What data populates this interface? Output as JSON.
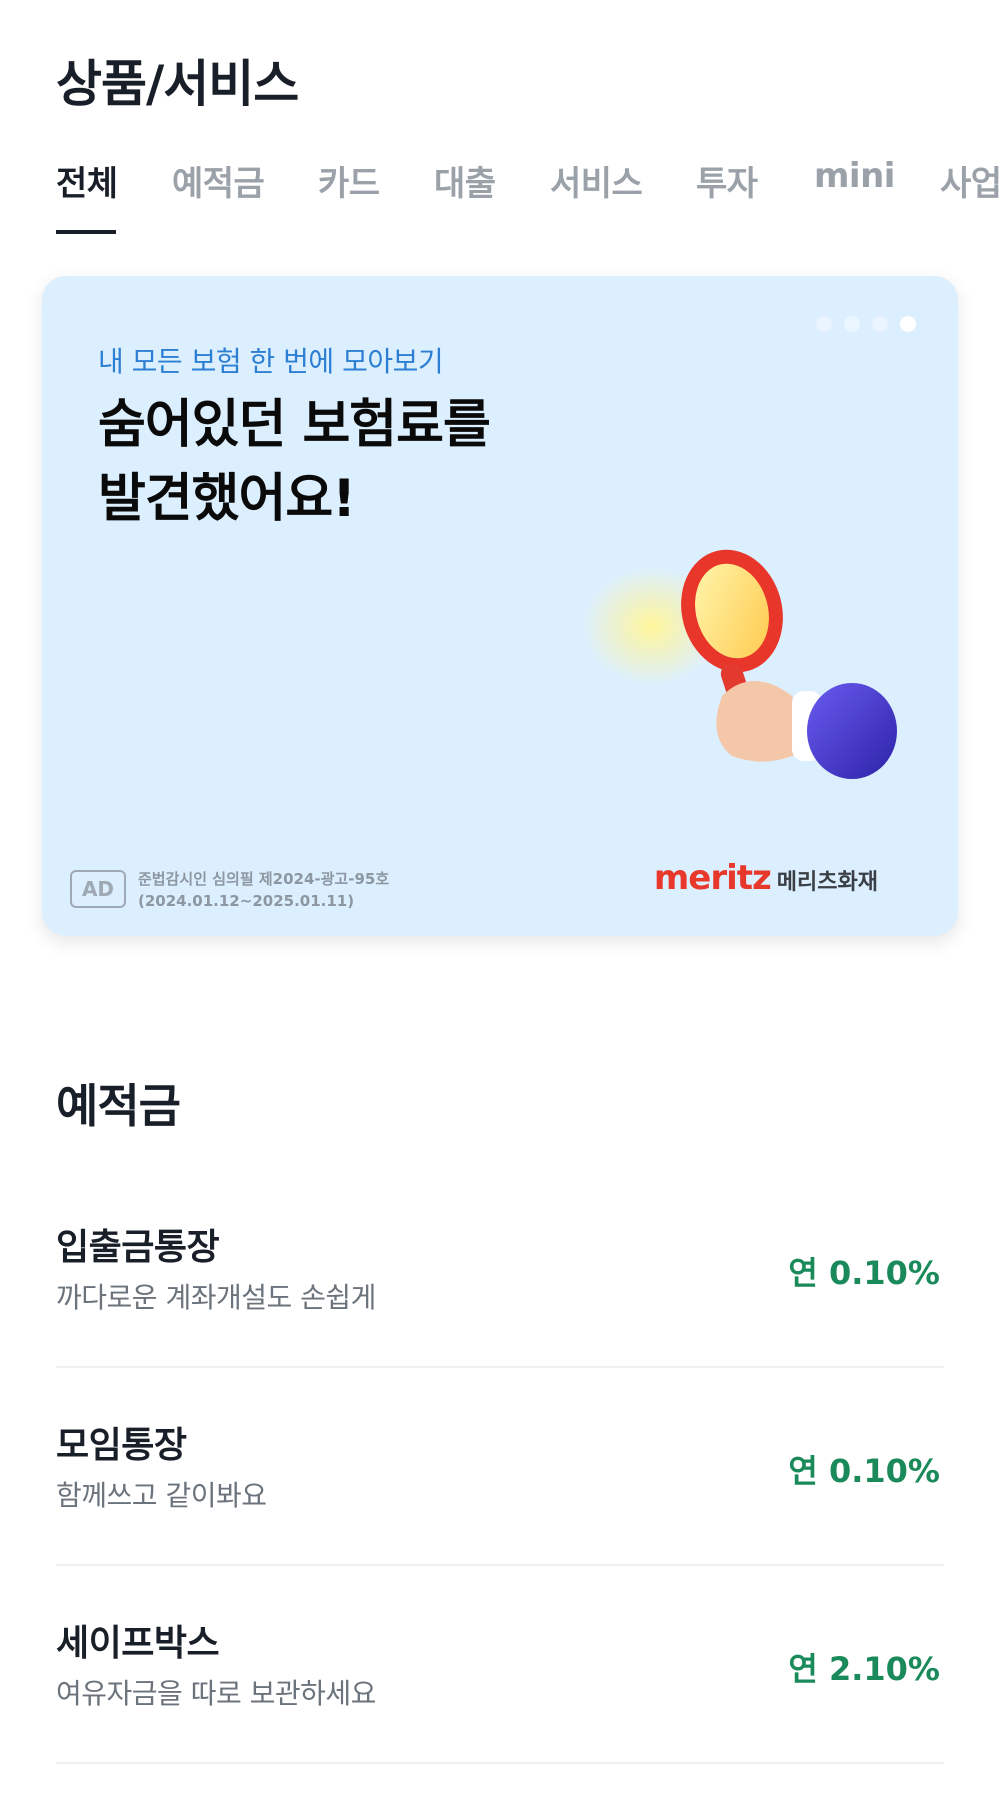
{
  "header": {
    "title": "상품/서비스"
  },
  "tabs": [
    {
      "label": "전체",
      "active": true
    },
    {
      "label": "예적금"
    },
    {
      "label": "카드"
    },
    {
      "label": "대출"
    },
    {
      "label": "서비스"
    },
    {
      "label": "투자"
    },
    {
      "label": "mini"
    },
    {
      "label": "사업"
    }
  ],
  "banner": {
    "subtitle": "내 모든 보험 한 번에 모아보기",
    "headline_line1": "숨어있던 보험료를",
    "headline_line2": "발견했어요!",
    "ad_badge": "AD",
    "ad_notice_line1": "준법감시인 심의필 제2024-광고-95호",
    "ad_notice_line2": "(2024.01.12~2025.01.11)",
    "brand_logo": "meritz",
    "brand_name": "메리츠화재",
    "page_dots": 4,
    "active_dot": 4,
    "background_color": "#dcefff",
    "illustration": "magnifying-glass-hand-icon"
  },
  "savings_section": {
    "title": "예적금",
    "items": [
      {
        "name": "입출금통장",
        "description": "까다로운 계좌개설도 손쉽게",
        "rate": "연 0.10%"
      },
      {
        "name": "모임통장",
        "description": "함께쓰고 같이봐요",
        "rate": "연 0.10%"
      },
      {
        "name": "세이프박스",
        "description": "여유자금을 따로 보관하세요",
        "rate": "연 2.10%"
      }
    ]
  },
  "colors": {
    "rate_green": "#1b8a5a",
    "brand_red": "#e8382b",
    "banner_subtitle_blue": "#2d7fd4"
  }
}
